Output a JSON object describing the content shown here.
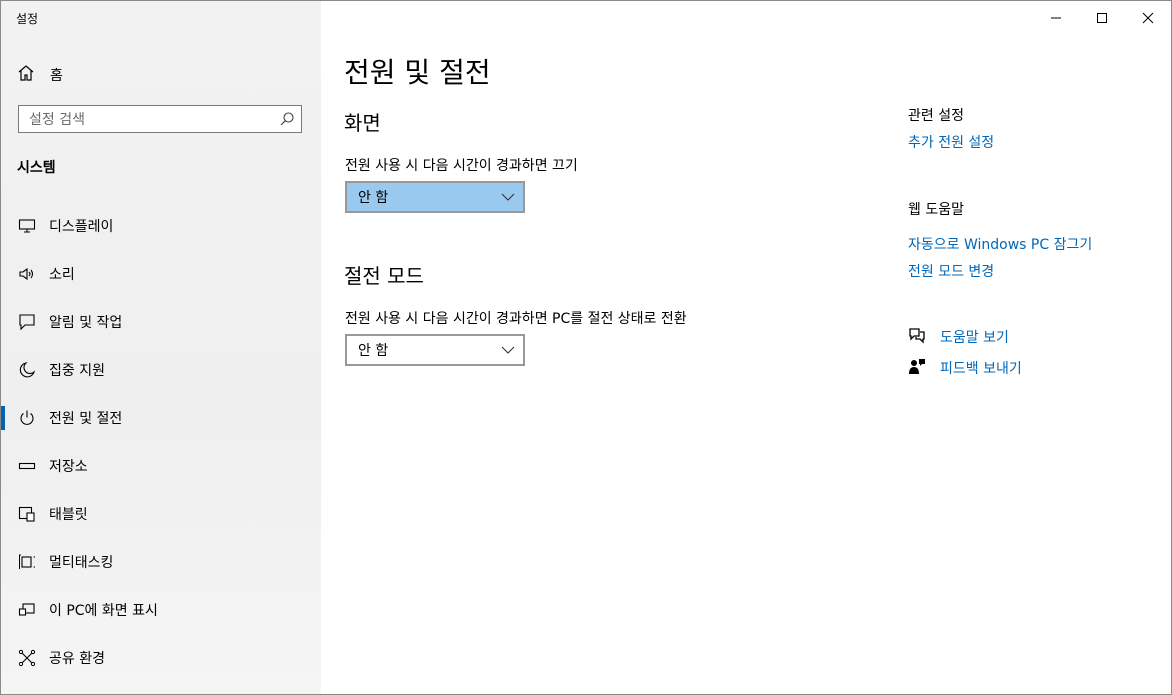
{
  "window": {
    "title": "설정"
  },
  "sidebar": {
    "home_label": "홈",
    "search_placeholder": "설정 검색",
    "section_title": "시스템",
    "items": [
      {
        "label": "디스플레이",
        "icon": "monitor-icon"
      },
      {
        "label": "소리",
        "icon": "speaker-icon"
      },
      {
        "label": "알림 및 작업",
        "icon": "notification-icon"
      },
      {
        "label": "집중 지원",
        "icon": "moon-icon"
      },
      {
        "label": "전원 및 절전",
        "icon": "power-icon",
        "active": true
      },
      {
        "label": "저장소",
        "icon": "storage-icon"
      },
      {
        "label": "태블릿",
        "icon": "tablet-icon"
      },
      {
        "label": "멀티태스킹",
        "icon": "multitasking-icon"
      },
      {
        "label": "이 PC에 화면 표시",
        "icon": "project-icon"
      },
      {
        "label": "공유 환경",
        "icon": "shared-experience-icon"
      }
    ]
  },
  "main": {
    "title": "전원 및 절전",
    "screen": {
      "heading": "화면",
      "description": "전원 사용 시 다음 시간이 경과하면 끄기",
      "value": "안 함"
    },
    "sleep": {
      "heading": "절전 모드",
      "description": "전원 사용 시 다음 시간이 경과하면 PC를 절전 상태로 전환",
      "value": "안 함"
    }
  },
  "related": {
    "heading": "관련 설정",
    "link": "추가 전원 설정"
  },
  "web_help": {
    "heading": "웹 도움말",
    "links": [
      "자동으로 Windows PC 잠그기",
      "전원 모드 변경"
    ]
  },
  "support": {
    "get_help": "도움말 보기",
    "feedback": "피드백 보내기"
  },
  "colors": {
    "accent": "#0063b1",
    "link": "#0067b8",
    "focused_dropdown": "#99c9ef"
  }
}
